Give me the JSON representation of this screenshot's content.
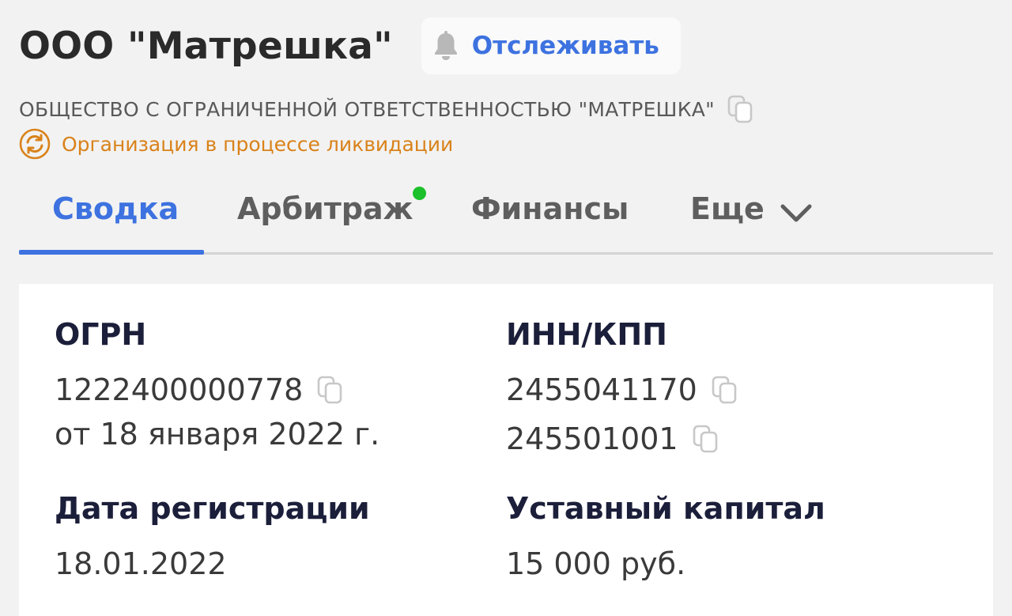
{
  "header": {
    "company_title": "ООО \"Матрешка\"",
    "follow_label": "Отслеживать",
    "full_name": "ОБЩЕСТВО С ОГРАНИЧЕННОЙ ОТВЕТСТВЕННОСТЬЮ \"МАТРЕШКА\"",
    "status_text": "Организация в процессе ликвидации"
  },
  "tabs": [
    {
      "label": "Сводка",
      "active": true
    },
    {
      "label": "Арбитраж",
      "has_notification": true
    },
    {
      "label": "Финансы"
    },
    {
      "label": "Еще"
    }
  ],
  "summary": {
    "ogrn": {
      "label": "ОГРН",
      "number": "1222400000778",
      "date": "от 18 января 2022 г."
    },
    "inn_kpp": {
      "label": "ИНН/КПП",
      "inn": "2455041170",
      "kpp": "245501001"
    },
    "registration": {
      "label": "Дата регистрации",
      "value": "18.01.2022"
    },
    "capital": {
      "label": "Уставный капитал",
      "value": "15 000 руб."
    }
  },
  "colors": {
    "accent": "#3d72e0",
    "status": "#d9821a",
    "notification": "#1cc02a",
    "label_dark": "#1c1f3a"
  },
  "icons": {
    "follow": "bell-icon",
    "copy": "copy-icon",
    "status": "liquidation-status-icon",
    "more": "chevron-down-icon"
  }
}
